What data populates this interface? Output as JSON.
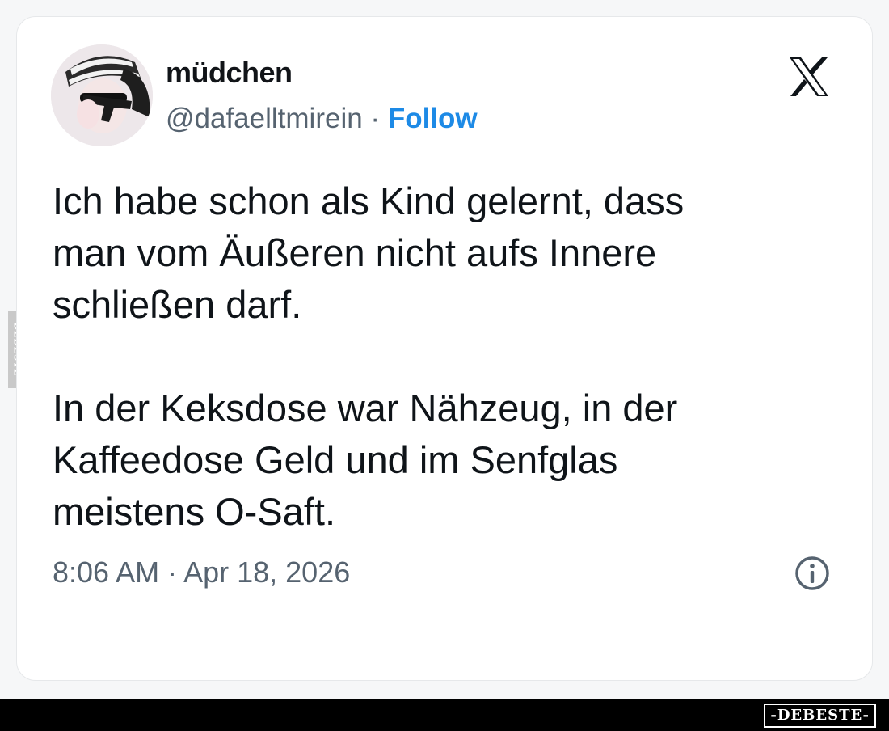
{
  "tweet": {
    "author_name": "müdchen",
    "handle": "@dafaelltmirein",
    "separator": "·",
    "follow_label": "Follow",
    "paragraphs": [
      [
        "Ich habe schon als Kind gelernt, dass",
        "man vom Äußeren nicht aufs Innere",
        "schließen darf."
      ],
      [
        "In der Keksdose war Nähzeug, in der",
        "Kaffeedose Geld und im Senfglas",
        "meistens O-Saft."
      ]
    ],
    "timestamp": "8:06 AM · Apr 18, 2026",
    "platform_icon": "x-logo-icon",
    "info_icon": "info-icon"
  },
  "watermark": {
    "side_text": "DEBESTE",
    "brand_text": "-DEBESTE-"
  },
  "colors": {
    "follow": "#1d8ae6",
    "text": "#0f1419",
    "secondary": "#566370",
    "bar": "#000000"
  }
}
